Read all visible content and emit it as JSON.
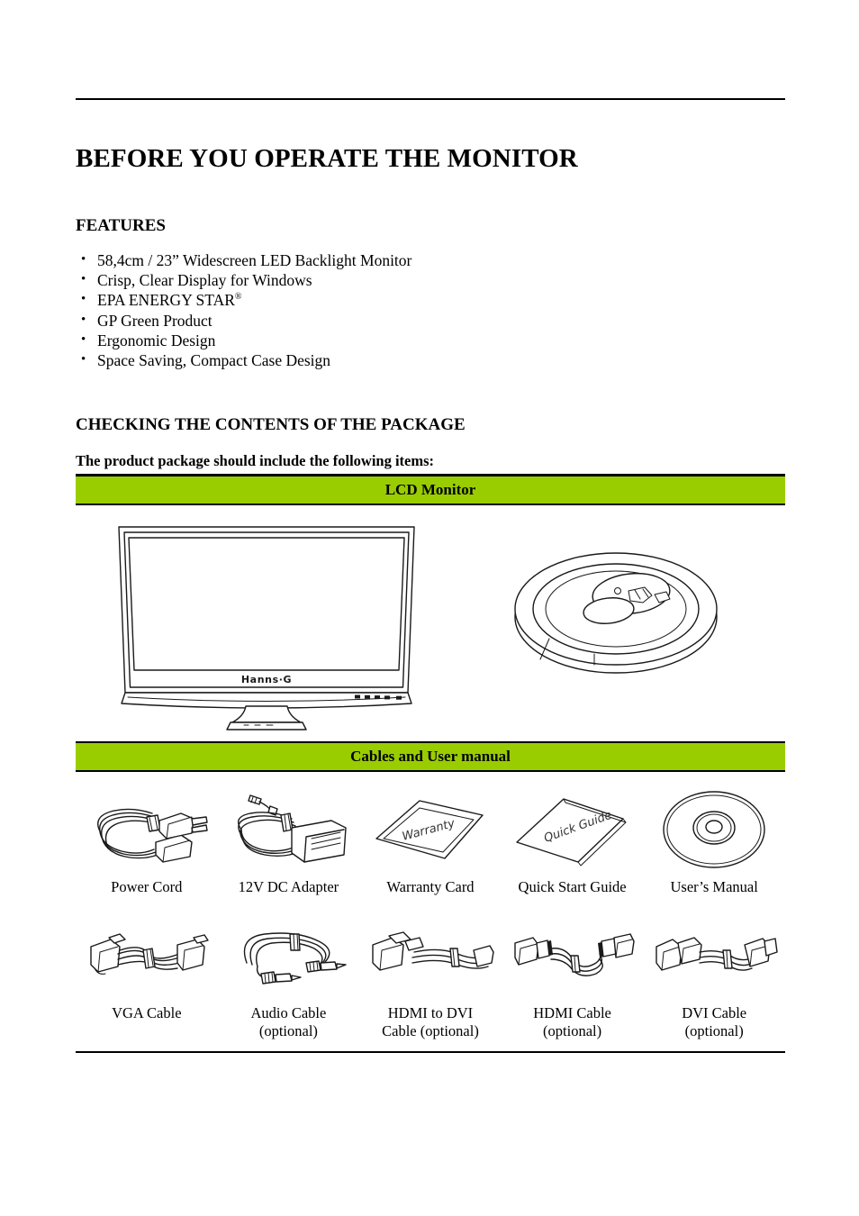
{
  "document": {
    "page_title": "BEFORE YOU OPERATE THE MONITOR",
    "sections": {
      "features_heading": "FEATURES",
      "checking_heading": "CHECKING THE CONTENTS OF THE PACKAGE",
      "table_intro": "The product package should include the following items:"
    },
    "features": [
      "58,4cm / 23” Widescreen LED Backlight Monitor",
      "Crisp, Clear Display for Windows",
      "EPA ENERGY STAR",
      "GP Green Product",
      "Ergonomic Design",
      "Space Saving, Compact Case Design"
    ],
    "features_superscript": "®",
    "package_table": {
      "header_monitor": "LCD Monitor",
      "header_cables": "Cables and User manual",
      "monitor_logo": "Hanns·G",
      "accessories_row_1": [
        {
          "label": "Power Cord",
          "icon": "power-cord-icon"
        },
        {
          "label": "12V DC Adapter",
          "icon": "dc-adapter-icon"
        },
        {
          "label": "Warranty Card",
          "icon": "warranty-card-icon"
        },
        {
          "label": "Quick Start Guide",
          "icon": "quick-start-guide-icon"
        },
        {
          "label": "User’s Manual",
          "icon": "cd-disc-icon"
        }
      ],
      "accessories_row_2": [
        {
          "label": "VGA Cable",
          "icon": "vga-cable-icon"
        },
        {
          "label": "Audio Cable\n(optional)",
          "icon": "audio-cable-icon"
        },
        {
          "label": "HDMI to DVI\nCable (optional)",
          "icon": "hdmi-to-dvi-cable-icon"
        },
        {
          "label": "HDMI Cable\n(optional)",
          "icon": "hdmi-cable-icon"
        },
        {
          "label": "DVI Cable\n(optional)",
          "icon": "dvi-cable-icon"
        }
      ],
      "artwork_labels": {
        "warranty_card_text": "Warranty",
        "quick_guide_text": "Quick Guide"
      }
    },
    "colors": {
      "table_header_green": "#9ACD00",
      "rule_black": "#000000",
      "page_background": "#FFFFFF"
    }
  }
}
